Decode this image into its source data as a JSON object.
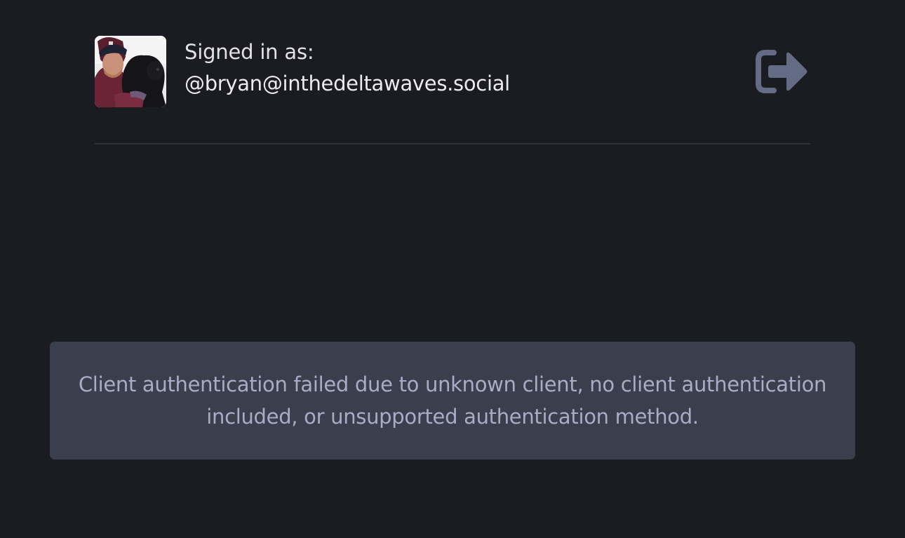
{
  "account": {
    "signed_in_label": "Signed in as:",
    "handle": "@bryan@inthedeltawaves.social",
    "logout_icon": "sign-out-icon"
  },
  "error": {
    "message": "Client authentication failed due to unknown client, no client authentication included, or unsupported authentication method."
  },
  "colors": {
    "background": "#1b1c21",
    "divider": "#30313b",
    "error_box": "#3b3f4d",
    "error_text": "#a7adc4",
    "logout_icon": "#646b85"
  }
}
